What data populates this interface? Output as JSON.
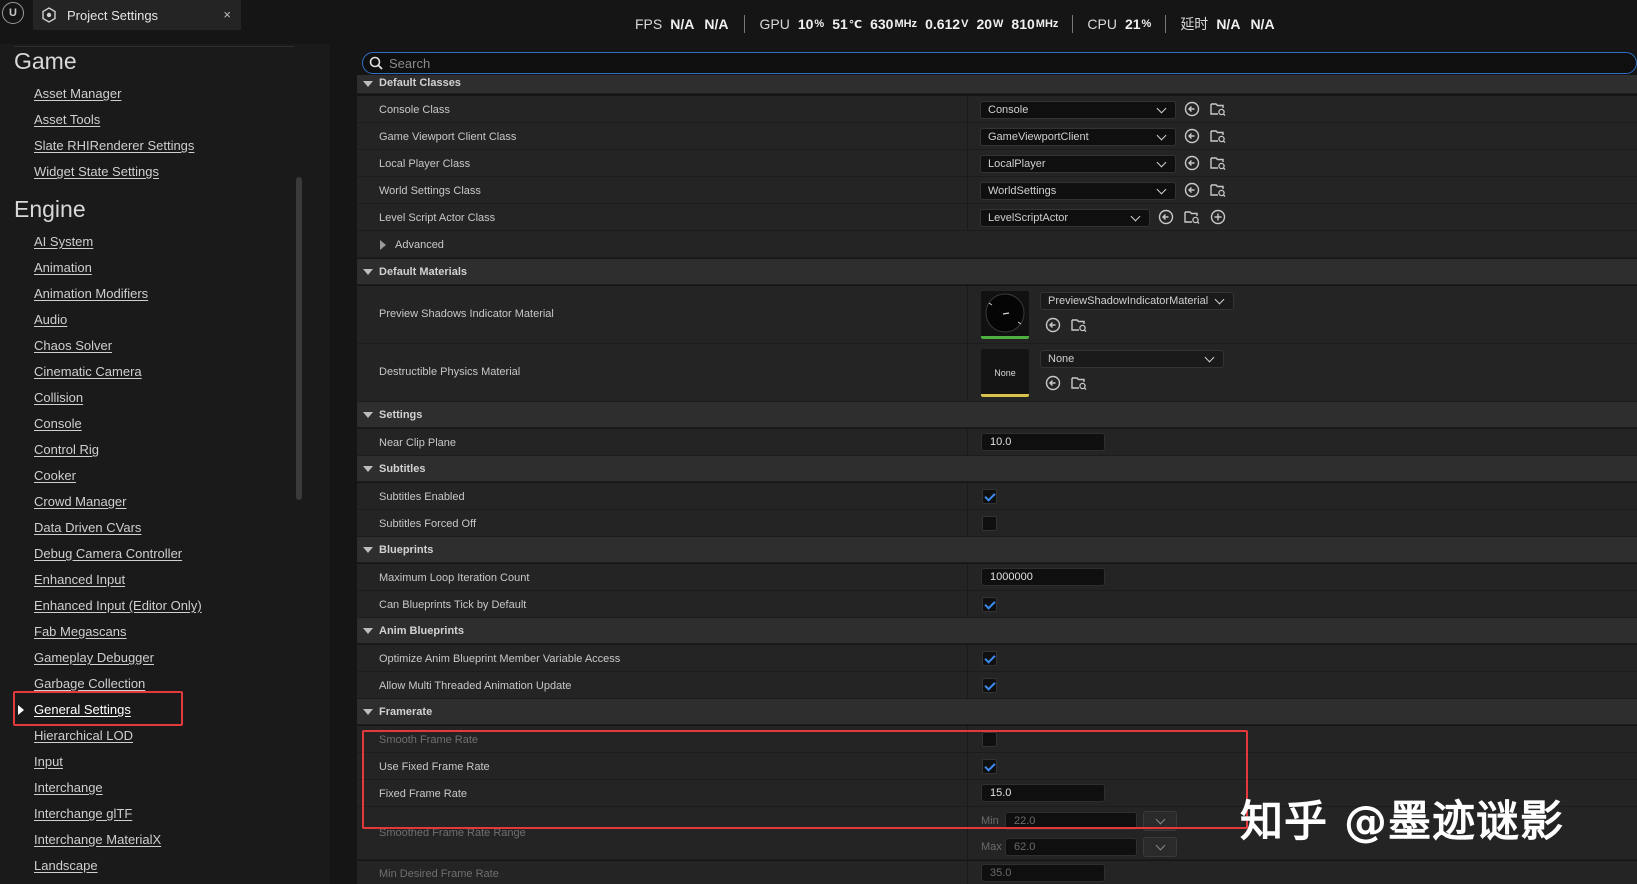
{
  "tab": {
    "title": "Project Settings",
    "close": "×"
  },
  "stats": {
    "fps_label": "FPS",
    "fps_value1": "N/A",
    "fps_value2": "N/A",
    "gpu_label": "GPU",
    "gpu_usage": "10",
    "gpu_usage_unit": "%",
    "gpu_temp": "51",
    "gpu_temp_unit": "℃",
    "gpu_clock": "630",
    "gpu_clock_unit": "MHz",
    "gpu_voltage": "0.612",
    "gpu_voltage_unit": "V",
    "gpu_power": "20",
    "gpu_power_unit": "W",
    "gpu_mem_clock": "810",
    "gpu_mem_clock_unit": "MHz",
    "cpu_label": "CPU",
    "cpu_usage": "21",
    "cpu_usage_unit": "%",
    "latency_label": "延时",
    "latency_value1": "N/A",
    "latency_value2": "N/A"
  },
  "search": {
    "placeholder": "Search"
  },
  "sidebar": {
    "game_title": "Game",
    "game_items": [
      "Asset Manager",
      "Asset Tools",
      "Slate RHIRenderer Settings",
      "Widget State Settings"
    ],
    "engine_title": "Engine",
    "engine_items": [
      "AI System",
      "Animation",
      "Animation Modifiers",
      "Audio",
      "Chaos Solver",
      "Cinematic Camera",
      "Collision",
      "Console",
      "Control Rig",
      "Cooker",
      "Crowd Manager",
      "Data Driven CVars",
      "Debug Camera Controller",
      "Enhanced Input",
      "Enhanced Input (Editor Only)",
      "Fab Megascans",
      "Gameplay Debugger",
      "Garbage Collection",
      "General Settings",
      "Hierarchical LOD",
      "Input",
      "Interchange",
      "Interchange glTF",
      "Interchange MaterialX",
      "Landscape"
    ],
    "active_item": "General Settings"
  },
  "sections": {
    "default_classes": "Default Classes",
    "default_materials": "Default Materials",
    "settings": "Settings",
    "subtitles": "Subtitles",
    "blueprints": "Blueprints",
    "anim_blueprints": "Anim Blueprints",
    "framerate": "Framerate"
  },
  "props": {
    "console_class": {
      "label": "Console Class",
      "value": "Console"
    },
    "game_viewport_client_class": {
      "label": "Game Viewport Client Class",
      "value": "GameViewportClient"
    },
    "local_player_class": {
      "label": "Local Player Class",
      "value": "LocalPlayer"
    },
    "world_settings_class": {
      "label": "World Settings Class",
      "value": "WorldSettings"
    },
    "level_script_actor_class": {
      "label": "Level Script Actor Class",
      "value": "LevelScriptActor"
    },
    "advanced": {
      "label": "Advanced"
    },
    "preview_shadows_indicator_material": {
      "label": "Preview Shadows Indicator Material",
      "value": "PreviewShadowIndicatorMaterial"
    },
    "destructible_physics_material": {
      "label": "Destructible Physics Material",
      "value": "None",
      "thumb": "None"
    },
    "near_clip_plane": {
      "label": "Near Clip Plane",
      "value": "10.0"
    },
    "subtitles_enabled": {
      "label": "Subtitles Enabled",
      "checked": true
    },
    "subtitles_forced_off": {
      "label": "Subtitles Forced Off",
      "checked": false
    },
    "maximum_loop_iteration_count": {
      "label": "Maximum Loop Iteration Count",
      "value": "1000000"
    },
    "can_blueprints_tick_by_default": {
      "label": "Can Blueprints Tick by Default",
      "checked": true
    },
    "optimize_anim_blueprint_member_variable_access": {
      "label": "Optimize Anim Blueprint Member Variable Access",
      "checked": true
    },
    "allow_multi_threaded_animation_update": {
      "label": "Allow Multi Threaded Animation Update",
      "checked": true
    },
    "smooth_frame_rate": {
      "label": "Smooth Frame Rate",
      "checked": false
    },
    "use_fixed_frame_rate": {
      "label": "Use Fixed Frame Rate",
      "checked": true
    },
    "fixed_frame_rate": {
      "label": "Fixed Frame Rate",
      "value": "15.0"
    },
    "smoothed_frame_rate_range": {
      "label": "Smoothed Frame Rate Range",
      "min_label": "Min",
      "min_value": "22.0",
      "max_label": "Max",
      "max_value": "62.0"
    },
    "min_desired_frame_rate": {
      "label": "Min Desired Frame Rate",
      "value": "35.0"
    }
  },
  "watermark": "知乎 @墨迹谜影",
  "colors": {
    "accent_blue": "#3e8bf0",
    "highlight_red": "#e23a3a",
    "thumb_green": "#4caf3f",
    "thumb_yellow": "#d6c24a"
  }
}
